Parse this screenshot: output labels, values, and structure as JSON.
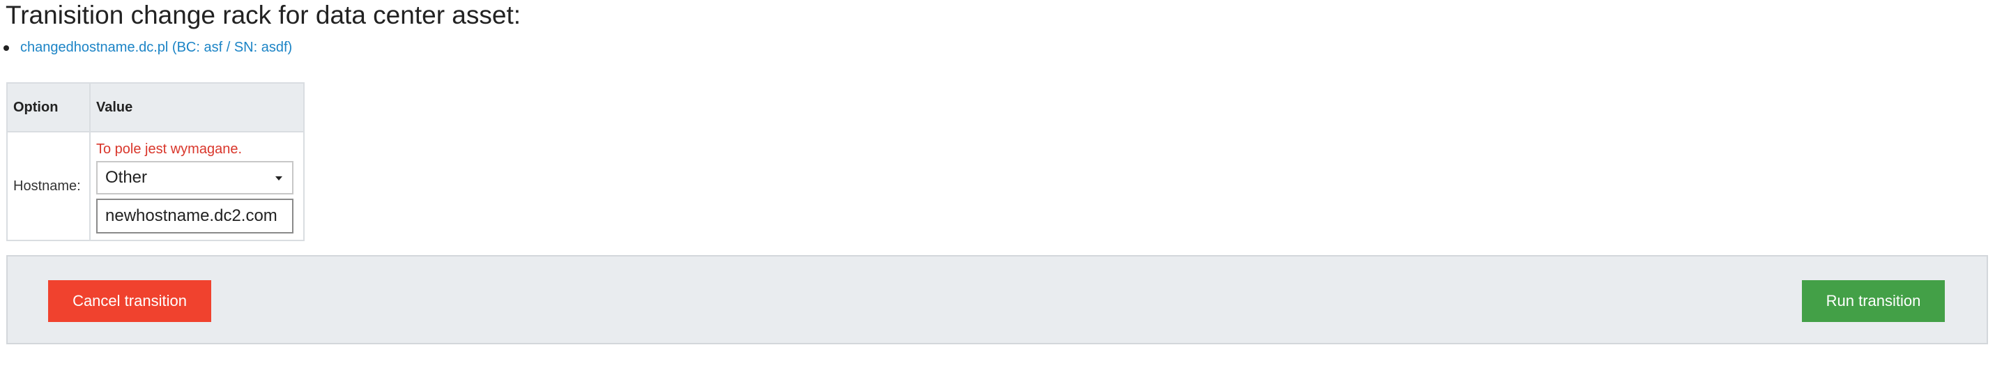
{
  "page": {
    "title": "Tranisition change rack for data center asset:"
  },
  "assets": [
    {
      "label": "changedhostname.dc.pl (BC: asf / SN: asdf)"
    }
  ],
  "table": {
    "headers": {
      "option": "Option",
      "value": "Value"
    },
    "rows": [
      {
        "option": "Hostname:",
        "error": "To pole jest wymagane.",
        "select_value": "Other",
        "input_value": "newhostname.dc2.com"
      }
    ]
  },
  "actions": {
    "cancel_label": "Cancel transition",
    "run_label": "Run transition"
  },
  "colors": {
    "link": "#1c84c6",
    "error": "#d9362b",
    "cancel_button": "#f0422e",
    "run_button": "#43a047",
    "panel_background": "#e9ecef"
  },
  "icons": {
    "select_caret": "caret-down-icon",
    "list_bullet": "bullet-icon"
  }
}
